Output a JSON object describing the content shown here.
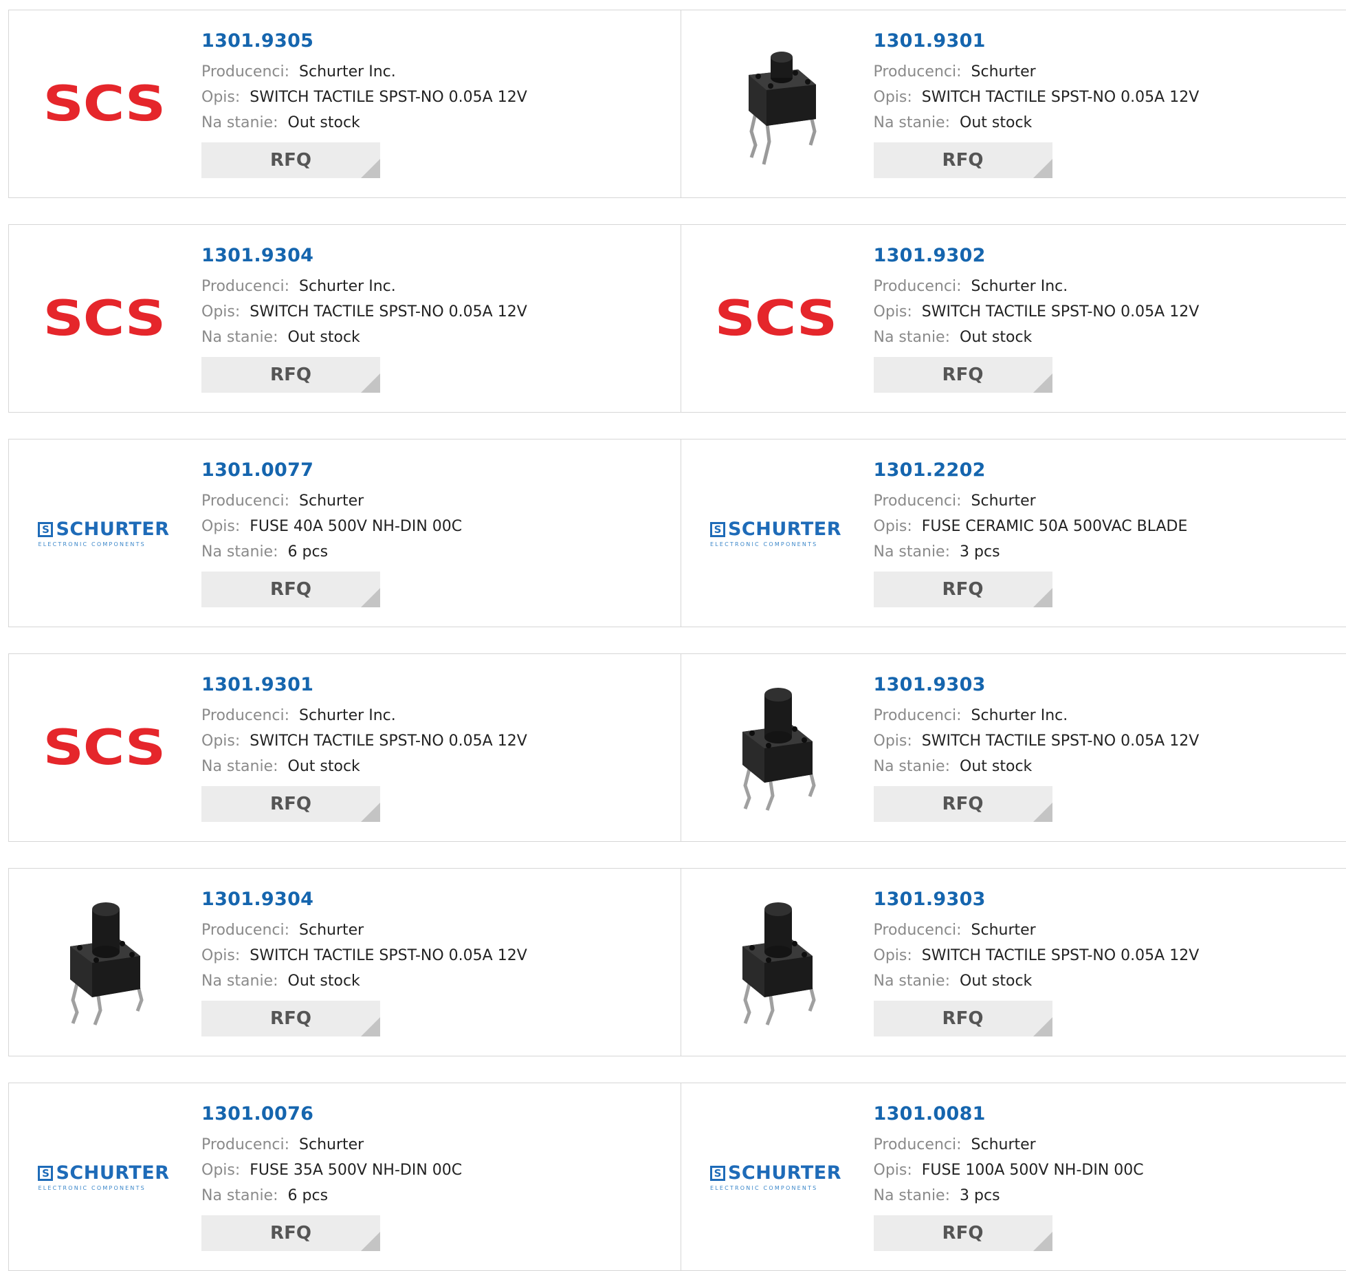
{
  "labels": {
    "manufacturer": "Producenci:",
    "description": "Opis:",
    "stock": "Na stanie:",
    "rfq": "RFQ"
  },
  "logos": {
    "scs": "SCS",
    "schurter_mark": "S",
    "schurter_word": "SCHURTER",
    "schurter_sub": "ELECTRONIC COMPONENTS"
  },
  "colors": {
    "part_number": "#1565ae",
    "scs_red": "#e5262b",
    "schurter_blue": "#1e6bb8",
    "rfq_bg": "#ececec"
  },
  "products": [
    {
      "part_number": "1301.9305",
      "image": "scs-logo",
      "manufacturer": "Schurter Inc.",
      "description": "SWITCH TACTILE SPST-NO 0.05A 12V",
      "stock": "Out stock"
    },
    {
      "part_number": "1301.9301",
      "image": "tactile-switch-short",
      "manufacturer": "Schurter",
      "description": "SWITCH TACTILE SPST-NO 0.05A 12V",
      "stock": "Out stock"
    },
    {
      "part_number": "1301.9304",
      "image": "scs-logo",
      "manufacturer": "Schurter Inc.",
      "description": "SWITCH TACTILE SPST-NO 0.05A 12V",
      "stock": "Out stock"
    },
    {
      "part_number": "1301.9302",
      "image": "scs-logo",
      "manufacturer": "Schurter Inc.",
      "description": "SWITCH TACTILE SPST-NO 0.05A 12V",
      "stock": "Out stock"
    },
    {
      "part_number": "1301.0077",
      "image": "schurter-logo",
      "manufacturer": "Schurter",
      "description": "FUSE 40A 500V NH-DIN 00C",
      "stock": "6 pcs"
    },
    {
      "part_number": "1301.2202",
      "image": "schurter-logo",
      "manufacturer": "Schurter",
      "description": "FUSE CERAMIC 50A 500VAC BLADE",
      "stock": "3 pcs"
    },
    {
      "part_number": "1301.9301",
      "image": "scs-logo",
      "manufacturer": "Schurter Inc.",
      "description": "SWITCH TACTILE SPST-NO 0.05A 12V",
      "stock": "Out stock"
    },
    {
      "part_number": "1301.9303",
      "image": "tactile-switch-tall",
      "manufacturer": "Schurter Inc.",
      "description": "SWITCH TACTILE SPST-NO 0.05A 12V",
      "stock": "Out stock"
    },
    {
      "part_number": "1301.9304",
      "image": "tactile-switch-tall",
      "manufacturer": "Schurter",
      "description": "SWITCH TACTILE SPST-NO 0.05A 12V",
      "stock": "Out stock"
    },
    {
      "part_number": "1301.9303",
      "image": "tactile-switch-tall",
      "manufacturer": "Schurter",
      "description": "SWITCH TACTILE SPST-NO 0.05A 12V",
      "stock": "Out stock"
    },
    {
      "part_number": "1301.0076",
      "image": "schurter-logo",
      "manufacturer": "Schurter",
      "description": "FUSE 35A 500V NH-DIN 00C",
      "stock": "6 pcs"
    },
    {
      "part_number": "1301.0081",
      "image": "schurter-logo",
      "manufacturer": "Schurter",
      "description": "FUSE 100A 500V NH-DIN 00C",
      "stock": "3 pcs"
    }
  ]
}
